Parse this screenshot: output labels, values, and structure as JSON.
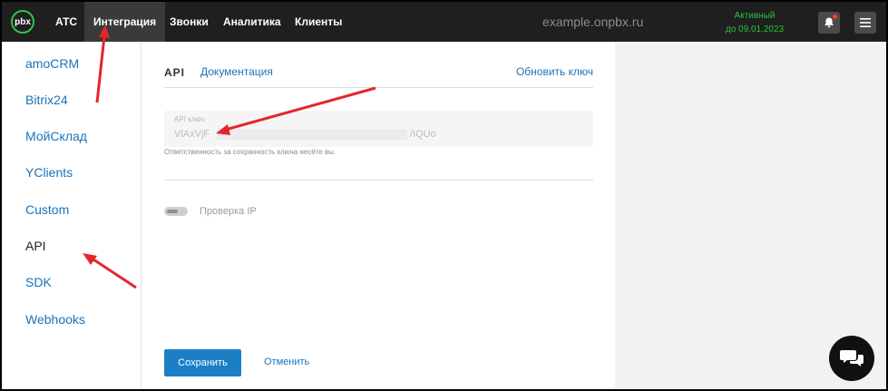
{
  "header": {
    "logo_text": "pbx",
    "nav": [
      {
        "label": "АТС",
        "active": false
      },
      {
        "label": "Интеграция",
        "active": true
      },
      {
        "label": "Звонки",
        "active": false
      },
      {
        "label": "Аналитика",
        "active": false
      },
      {
        "label": "Клиенты",
        "active": false
      }
    ],
    "domain": "example.onpbx.ru",
    "status_line1": "Активный",
    "status_line2": "до 09.01.2023",
    "status_color": "#27c23c"
  },
  "sidebar": {
    "items": [
      {
        "label": "amoCRM"
      },
      {
        "label": "Bitrix24"
      },
      {
        "label": "МойСклад"
      },
      {
        "label": "YClients"
      },
      {
        "label": "Custom"
      },
      {
        "label": "API",
        "current": true
      },
      {
        "label": "SDK"
      },
      {
        "label": "Webhooks"
      }
    ]
  },
  "main": {
    "title": "API",
    "doc_link": "Документация",
    "refresh_link": "Обновить ключ",
    "key_field_label": "API ключ",
    "key_prefix": "VlAxVjF",
    "key_suffix": "/IQUo",
    "helper_text": "Ответственность за сохранность ключа несёте вы.",
    "ip_check_label": "Проверка IP",
    "ip_check_enabled": false,
    "save_label": "Сохранить",
    "cancel_label": "Отменить"
  },
  "colors": {
    "accent": "#1c7fc6",
    "topbar": "#1f1f1f",
    "annotation_arrow": "#e3262b"
  },
  "icons": [
    "logo-icon",
    "bell-icon",
    "menu-icon",
    "chat-icon"
  ]
}
